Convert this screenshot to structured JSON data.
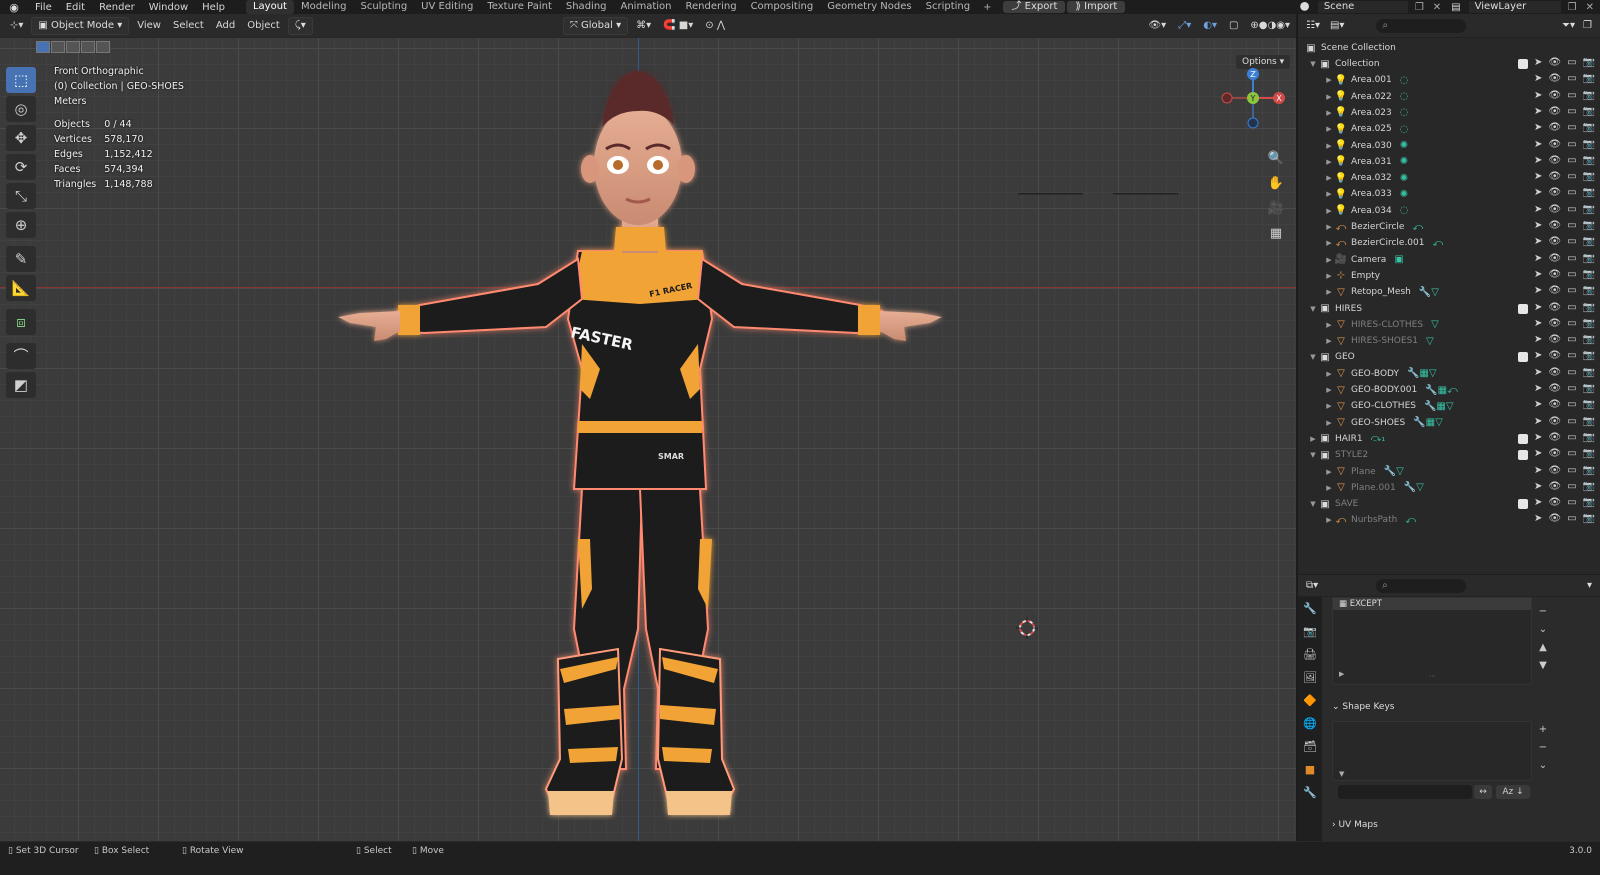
{
  "topbar": {
    "menus": [
      "File",
      "Edit",
      "Render",
      "Window",
      "Help"
    ],
    "workspaces": [
      "Layout",
      "Modeling",
      "Sculpting",
      "UV Editing",
      "Texture Paint",
      "Shading",
      "Animation",
      "Rendering",
      "Compositing",
      "Geometry Nodes",
      "Scripting"
    ],
    "active_workspace": "Layout",
    "export_label": "Export",
    "import_label": "Import",
    "scene_name": "Scene",
    "viewlayer_name": "ViewLayer"
  },
  "viewport": {
    "mode": "Object Mode",
    "menus": [
      "View",
      "Select",
      "Add",
      "Object"
    ],
    "transform_orientation": "Global",
    "options_label": "Options",
    "overlay_info": {
      "view": "Front Orthographic",
      "collection": "(0) Collection | GEO-SHOES",
      "units": "Meters"
    },
    "stats": [
      {
        "label": "Objects",
        "value": "0 / 44"
      },
      {
        "label": "Vertices",
        "value": "578,170"
      },
      {
        "label": "Edges",
        "value": "1,152,412"
      },
      {
        "label": "Faces",
        "value": "574,394"
      },
      {
        "label": "Triangles",
        "value": "1,148,788"
      }
    ],
    "gizmo": {
      "x": "X",
      "y": "Y",
      "z": "Z"
    },
    "character_text": {
      "chest": "FASTER",
      "badge": "F1 RACER",
      "leg": "SMAR"
    },
    "colors": {
      "suit_black": "#1b1b1d",
      "suit_orange": "#f2a336",
      "skin": "#d99e84",
      "hair": "#5a2b2b",
      "glow": "#ff8a70"
    }
  },
  "outliner": {
    "root": "Scene Collection",
    "rows": [
      {
        "name": "Collection",
        "type": "collection",
        "level": 0,
        "dim": false,
        "extra": "",
        "checked": true
      },
      {
        "name": "Area.001",
        "type": "light",
        "level": 1,
        "dim": false,
        "extra": "◌"
      },
      {
        "name": "Area.022",
        "type": "light",
        "level": 1,
        "dim": false,
        "extra": "◌"
      },
      {
        "name": "Area.023",
        "type": "light",
        "level": 1,
        "dim": false,
        "extra": "◌"
      },
      {
        "name": "Area.025",
        "type": "light",
        "level": 1,
        "dim": false,
        "extra": "◌"
      },
      {
        "name": "Area.030",
        "type": "light",
        "level": 1,
        "dim": false,
        "extra": "✺"
      },
      {
        "name": "Area.031",
        "type": "light",
        "level": 1,
        "dim": false,
        "extra": "✺"
      },
      {
        "name": "Area.032",
        "type": "light",
        "level": 1,
        "dim": false,
        "extra": "✺"
      },
      {
        "name": "Area.033",
        "type": "light",
        "level": 1,
        "dim": false,
        "extra": "✺"
      },
      {
        "name": "Area.034",
        "type": "light",
        "level": 1,
        "dim": false,
        "extra": "◌"
      },
      {
        "name": "BezierCircle",
        "type": "curve",
        "level": 1,
        "dim": false,
        "extra": "⤺"
      },
      {
        "name": "BezierCircle.001",
        "type": "curve",
        "level": 1,
        "dim": false,
        "extra": "⤺"
      },
      {
        "name": "Camera",
        "type": "camera",
        "level": 1,
        "dim": false,
        "extra": "▣"
      },
      {
        "name": "Empty",
        "type": "empty",
        "level": 1,
        "dim": false,
        "extra": ""
      },
      {
        "name": "Retopo_Mesh",
        "type": "mesh",
        "level": 1,
        "dim": false,
        "extra": "🔧▽"
      },
      {
        "name": "HIRES",
        "type": "collection",
        "level": 0,
        "dim": false,
        "extra": "",
        "checked": true
      },
      {
        "name": "HIRES-CLOTHES",
        "type": "mesh",
        "level": 1,
        "dim": true,
        "extra": "▽"
      },
      {
        "name": "HIRES-SHOES1",
        "type": "mesh",
        "level": 1,
        "dim": true,
        "extra": "▽"
      },
      {
        "name": "GEO",
        "type": "collection",
        "level": 0,
        "dim": false,
        "extra": "",
        "checked": true
      },
      {
        "name": "GEO-BODY",
        "type": "mesh",
        "level": 1,
        "dim": false,
        "extra": "🔧▦▽"
      },
      {
        "name": "GEO-BODY.001",
        "type": "mesh",
        "level": 1,
        "dim": false,
        "extra": "🔧▦⤺"
      },
      {
        "name": "GEO-CLOTHES",
        "type": "mesh",
        "level": 1,
        "dim": false,
        "extra": "🔧▦▽"
      },
      {
        "name": "GEO-SHOES",
        "type": "mesh",
        "level": 1,
        "dim": false,
        "extra": "🔧▦▽"
      },
      {
        "name": "HAIR1",
        "type": "collection",
        "level": 0,
        "dim": false,
        "extra": "⤼₁",
        "checked": true
      },
      {
        "name": "STYLE2",
        "type": "collection",
        "level": 0,
        "dim": true,
        "extra": "",
        "checked": true
      },
      {
        "name": "Plane",
        "type": "mesh",
        "level": 1,
        "dim": true,
        "extra": "🔧▽"
      },
      {
        "name": "Plane.001",
        "type": "mesh",
        "level": 1,
        "dim": true,
        "extra": "🔧▽"
      },
      {
        "name": "SAVE",
        "type": "collection",
        "level": 0,
        "dim": true,
        "extra": "",
        "checked": true
      },
      {
        "name": "NurbsPath",
        "type": "curve",
        "level": 1,
        "dim": true,
        "extra": "⤺"
      }
    ]
  },
  "properties": {
    "list_item": "EXCEPT",
    "shape_keys_label": "Shape Keys",
    "uv_maps_label": "UV Maps",
    "sort_label": "Az"
  },
  "statusbar": {
    "items": [
      {
        "icon": "mouse-left-icon",
        "label": "Set 3D Cursor"
      },
      {
        "icon": "mouse-left-icon",
        "label": "Box Select"
      },
      {
        "icon": "mouse-middle-icon",
        "label": "Rotate View"
      },
      {
        "icon": "mouse-left-icon",
        "label": "Select"
      },
      {
        "icon": "mouse-left-icon",
        "label": "Move"
      }
    ],
    "version": "3.0.0"
  }
}
